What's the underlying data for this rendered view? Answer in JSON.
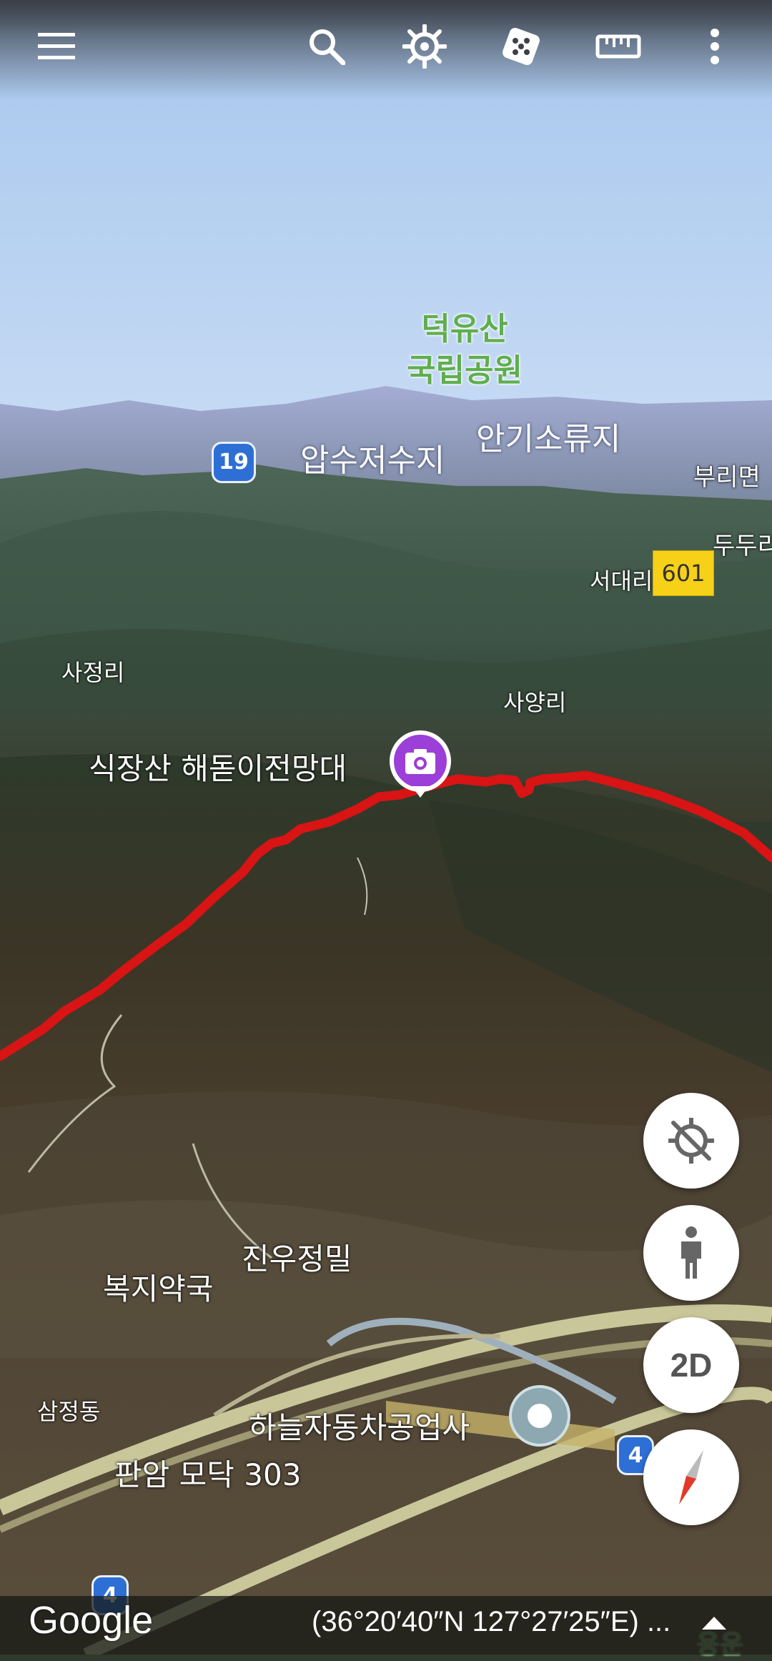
{
  "toolbar": {
    "icons": [
      "menu-icon",
      "search-icon",
      "voyager-icon",
      "feeling-lucky-icon",
      "measure-icon",
      "more-icon"
    ]
  },
  "map": {
    "park_label_line1": "덕유산",
    "park_label_line2": "국립공원",
    "labels": {
      "apsu": "압수저수지",
      "angiso": "안기소류지",
      "burimyeon": "부리면",
      "dudu": "두두리",
      "seodae": "서대리",
      "sajeong": "사정리",
      "sayang": "사양리",
      "photo_place": "식장산 해돋이전망대",
      "jinwoo": "진우정밀",
      "bokji": "복지약국",
      "samjeong": "삼정동",
      "haneul": "하늘자동차공업사",
      "panam": "판암 모닥 303",
      "yongun": "용운"
    },
    "shields": {
      "route19": "19",
      "route601": "601",
      "route4_right": "4",
      "route4_bottom": "4"
    },
    "colors": {
      "track": "#d81414",
      "photo_marker": "#9b3fd8",
      "route_shield_blue": "#2e6fd6",
      "route_shield_yellow": "#f7d117"
    }
  },
  "controls": {
    "compass_fab_label": "2D",
    "icons": [
      "location-off-icon",
      "street-view-icon",
      "compass-icon"
    ]
  },
  "footer": {
    "logo": "Google",
    "coordinates": "(36°20′40″N 127°27′25″E) ..."
  }
}
